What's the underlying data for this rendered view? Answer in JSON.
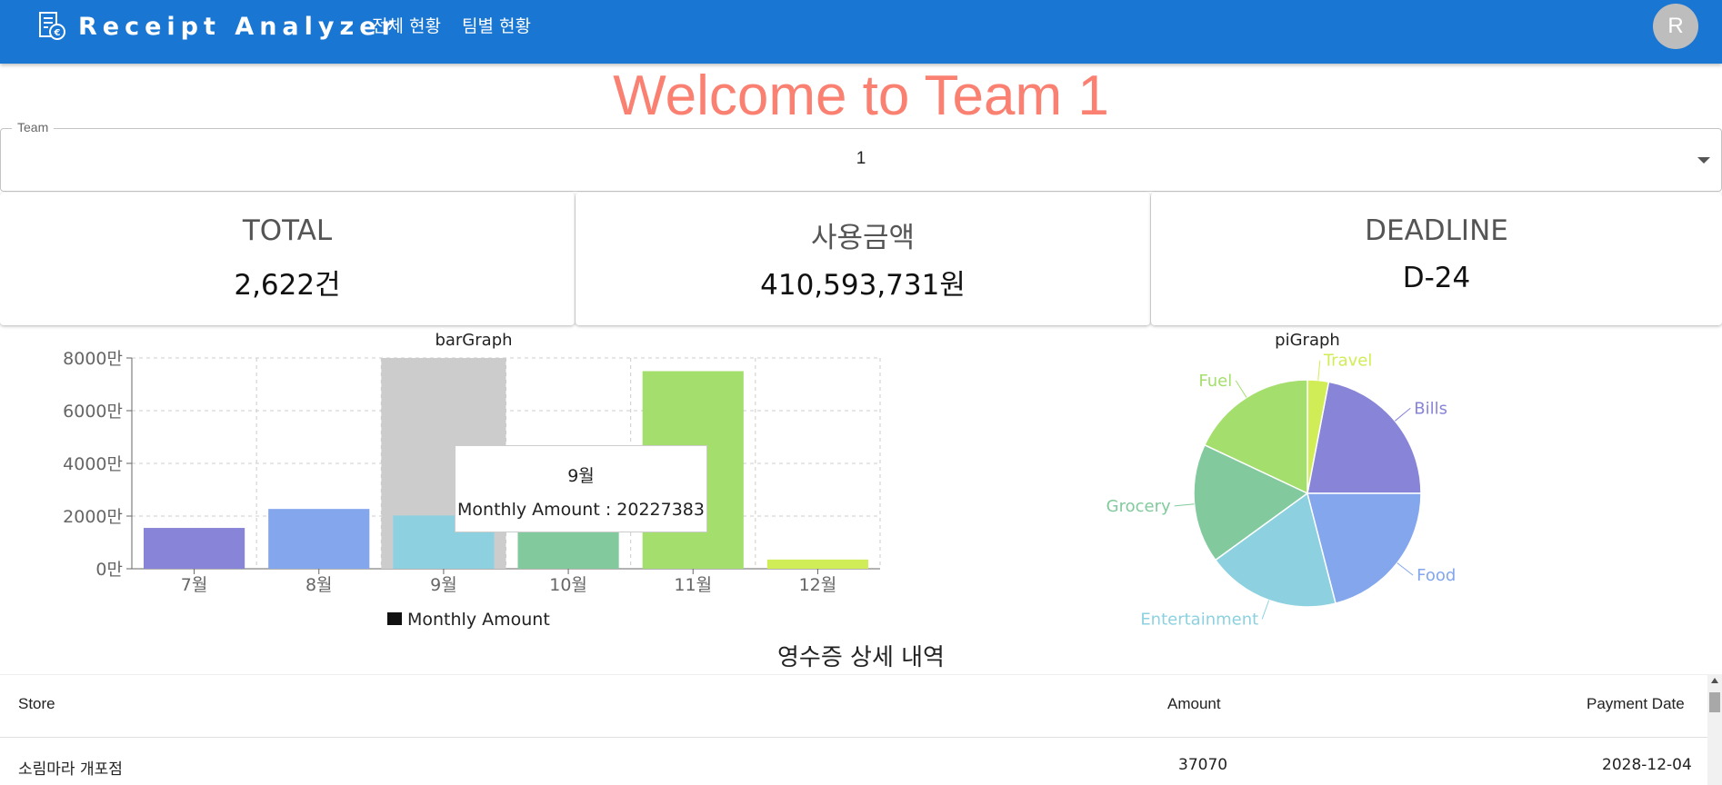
{
  "header": {
    "app_title": "Receipt Analyzer",
    "nav": [
      {
        "label": "전체 현황"
      },
      {
        "label": "팀별 현황"
      }
    ],
    "avatar_initial": "R",
    "colors": {
      "appbar": "#1976d2",
      "avatar": "#bdbdbd"
    }
  },
  "welcome_text": "Welcome to Team 1",
  "team_select": {
    "label": "Team",
    "value": "1"
  },
  "stats": [
    {
      "label": "TOTAL",
      "value": "2,622건"
    },
    {
      "label": "사용금액",
      "value": "410,593,731원"
    },
    {
      "label": "DEADLINE",
      "value": "D-24"
    }
  ],
  "tooltip": {
    "title": "9월",
    "line": "Monthly Amount : 20227383"
  },
  "chart_data": [
    {
      "type": "bar",
      "title": "barGraph",
      "categories": [
        "7월",
        "8월",
        "9월",
        "10월",
        "11월",
        "12월"
      ],
      "series": [
        {
          "name": "Monthly Amount",
          "values": [
            15500000,
            22700000,
            20227383,
            16500000,
            75000000,
            3500000
          ]
        }
      ],
      "y_ticks": [
        "0만",
        "2000만",
        "4000만",
        "6000만",
        "8000만"
      ],
      "ylim": [
        0,
        80000000
      ],
      "grid": true,
      "legend": "bottom",
      "bar_colors": [
        "#8884d8",
        "#83a6ed",
        "#8dd1e1",
        "#82ca9d",
        "#a4de6c",
        "#d0ed57"
      ],
      "highlight_category": "9월"
    },
    {
      "type": "pie",
      "title": "piGraph",
      "labels": [
        "Bills",
        "Travel",
        "Fuel",
        "Grocery",
        "Entertainment",
        "Food"
      ],
      "values": [
        22,
        3,
        18,
        17,
        19,
        21
      ],
      "colors": [
        "#8884d8",
        "#d0ed57",
        "#a4de6c",
        "#82ca9d",
        "#8dd1e1",
        "#83a6ed"
      ]
    }
  ],
  "receipts": {
    "title": "영수증 상세 내역",
    "columns": [
      "Store",
      "Amount",
      "Payment Date"
    ],
    "rows": [
      {
        "store": "소림마라 개포점",
        "amount": "37070",
        "date": "2028-12-04"
      }
    ]
  }
}
